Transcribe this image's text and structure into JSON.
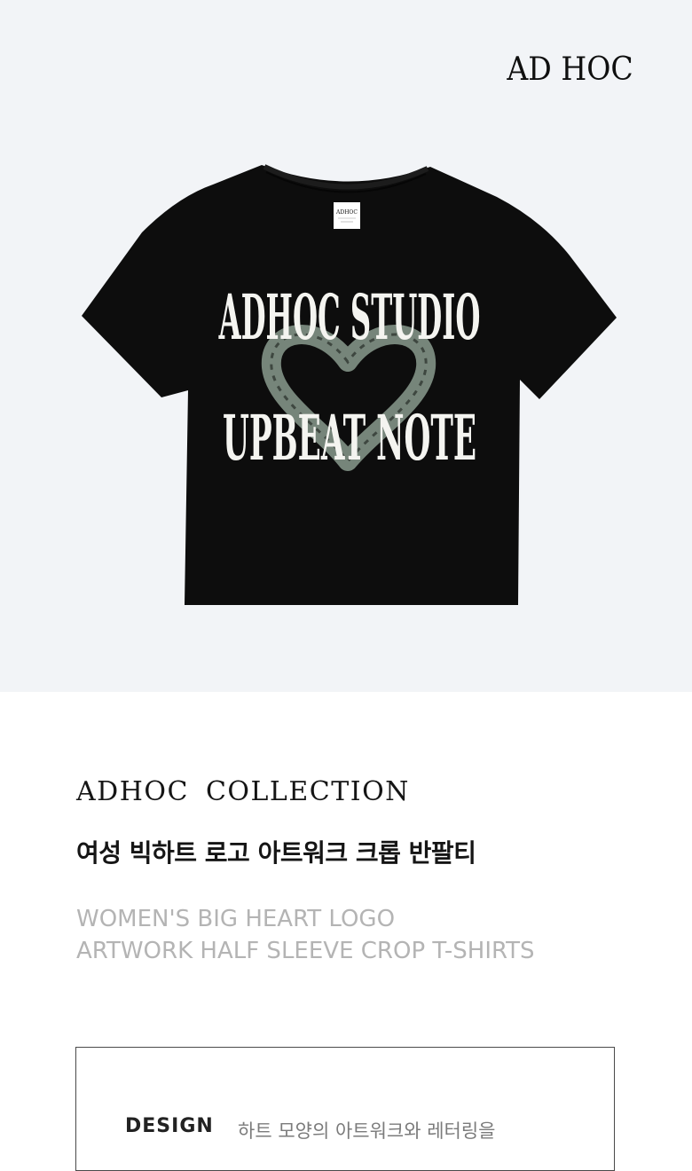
{
  "hero": {
    "brand": "AD HOC",
    "label_tag": "ADHOC",
    "print": {
      "line1": "ADHOC STUDIO",
      "line2": "UPBEAT NOTE"
    }
  },
  "product": {
    "collection": "ADHOC COLLECTION",
    "title_ko": "여성 빅하트 로고 아트워크 크롭 반팔티",
    "title_en": [
      "WOMEN'S BIG HEART LOGO",
      "ARTWORK HALF SLEEVE CROP T-SHIRTS"
    ]
  },
  "details": {
    "design_label": "DESIGN",
    "design_text": "하트 모양의 아트워크와 레터링을"
  },
  "colors": {
    "hero_bg": "#f2f4f7",
    "shirt": "#0d0d0d",
    "heart": "#76857a",
    "print_text": "#f4f4f0",
    "muted_text": "#b4b4b4"
  }
}
